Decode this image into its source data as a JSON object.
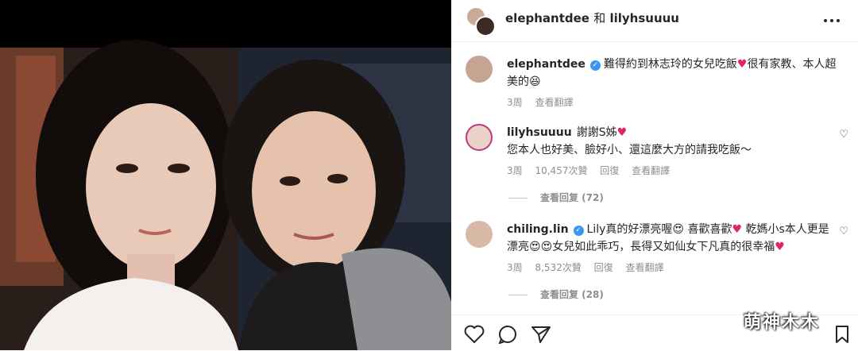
{
  "header": {
    "user1": "elephantdee",
    "and": "和",
    "user2": "lilyhsuuuu"
  },
  "icons": {
    "more": "more-dots-icon",
    "like": "heart-outline-icon",
    "comment": "comment-bubble-icon",
    "share": "send-icon",
    "save": "bookmark-icon",
    "verified": "verified-badge-icon"
  },
  "colors": {
    "accent": "#3897f0",
    "heart": "#e0245e",
    "meta": "#8e8e8e"
  },
  "caption": {
    "user": "elephantdee",
    "text_a": "難得約到林志玲的女兒吃飯",
    "text_b": "很有家教、本人超美的",
    "emoji_end": "😆",
    "time": "3周",
    "translate": "查看翻譯"
  },
  "comments": [
    {
      "user": "lilyhsuuuu",
      "text_a": "謝謝S姊",
      "text_b": "您本人也好美、臉好小、還這麼大方的請我吃飯～",
      "time": "3周",
      "likes": "10,457次贊",
      "reply": "回復",
      "translate": "查看翻譯",
      "view_replies": "查看回复 (72)"
    },
    {
      "user": "chiling.lin",
      "text_a": "Lily真的好漂亮喔",
      "text_b": "喜歡喜歡",
      "text_c": "乾媽小s本人更是漂亮",
      "text_d": "女兒如此乖巧，長得又如仙女下凡真的很幸福",
      "time": "3周",
      "likes": "8,532次贊",
      "reply": "回復",
      "translate": "查看翻譯",
      "view_replies": "查看回复 (28)"
    }
  ],
  "watermark": "萌神木木"
}
